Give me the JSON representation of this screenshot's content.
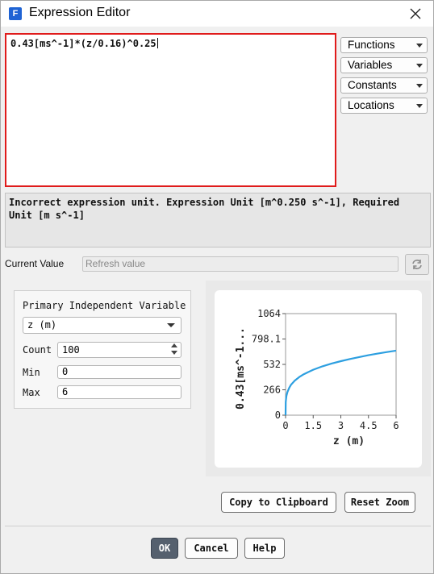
{
  "window": {
    "title": "Expression Editor",
    "app_icon_letter": "F"
  },
  "editor": {
    "expression": "0.43[ms^-1]*(z/0.16)^0.25"
  },
  "menus": [
    {
      "label": "Functions"
    },
    {
      "label": "Variables"
    },
    {
      "label": "Constants"
    },
    {
      "label": "Locations"
    }
  ],
  "message": {
    "text": "Incorrect expression unit. Expression Unit [m^0.250 s^-1], Required Unit [m s^-1]"
  },
  "current_value": {
    "label": "Current Value",
    "placeholder": "Refresh value"
  },
  "independent_variable": {
    "title": "Primary Independent Variable",
    "selected": "z (m)",
    "count_label": "Count",
    "count": "100",
    "min_label": "Min",
    "min": "0",
    "max_label": "Max",
    "max": "6"
  },
  "chart_data": {
    "type": "line",
    "xlabel": "z (m)",
    "ylabel": "0.43[ms^-1...",
    "xlim": [
      0,
      6
    ],
    "ylim": [
      0,
      1064
    ],
    "x_ticks": [
      "0",
      "1.5",
      "3",
      "4.5",
      "6"
    ],
    "y_ticks": [
      "0",
      "266",
      "532",
      "798.1",
      "1064"
    ],
    "line_color": "#2d9fe0",
    "series": [
      {
        "x": [
          0,
          0.01,
          0.02,
          0.05,
          0.1,
          0.2,
          0.3,
          0.5,
          0.75,
          1.0,
          1.5,
          2.0,
          2.5,
          3.0,
          3.5,
          4.0,
          4.5,
          5.0,
          5.5,
          6.0
        ],
        "y": [
          0,
          136,
          162,
          203,
          242,
          288,
          319,
          362,
          400,
          430,
          476,
          512,
          541,
          566,
          589,
          609,
          628,
          645,
          661,
          676
        ]
      }
    ]
  },
  "buttons": {
    "copy": "Copy to Clipboard",
    "reset_zoom": "Reset Zoom",
    "ok": "OK",
    "cancel": "Cancel",
    "help": "Help"
  }
}
